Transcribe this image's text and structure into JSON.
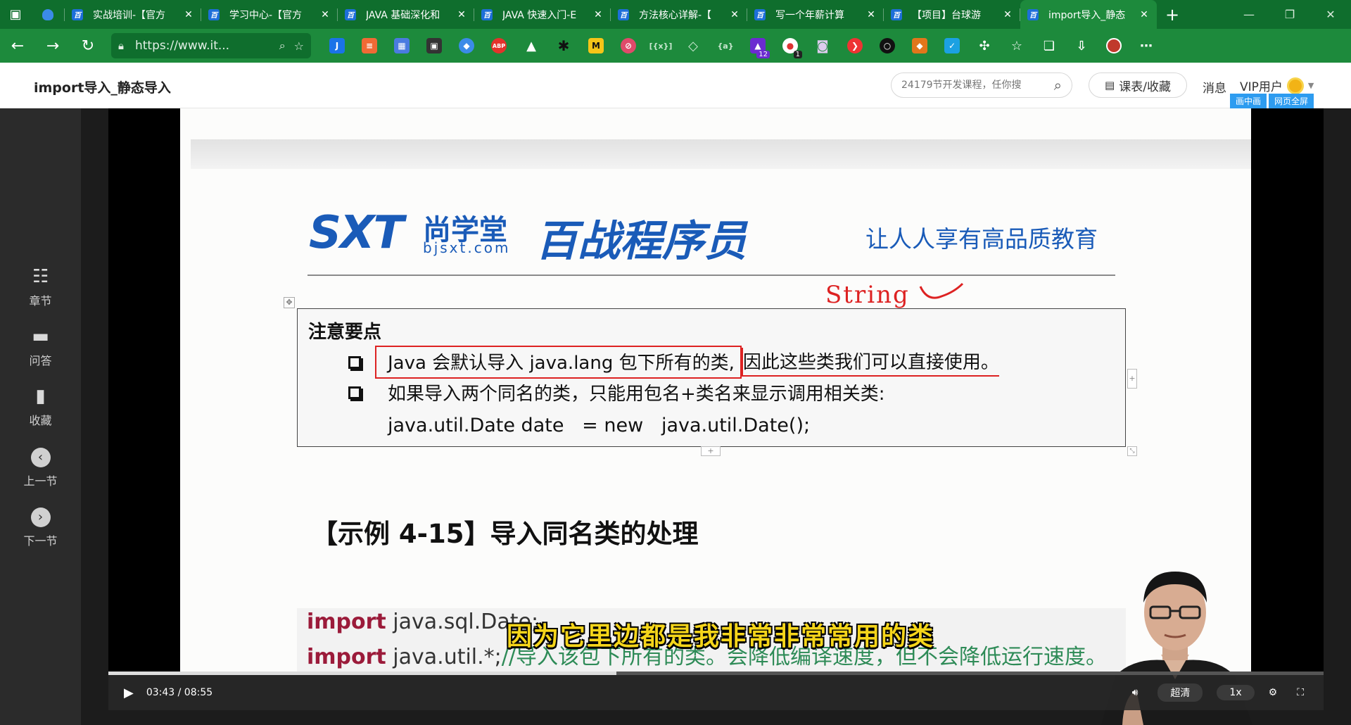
{
  "browser": {
    "tabs": [
      {
        "title": "",
        "favicon": "gem",
        "active": false
      },
      {
        "title": "实战培训-【官方",
        "favicon": "百",
        "active": false
      },
      {
        "title": "学习中心-【官方",
        "favicon": "百",
        "active": false
      },
      {
        "title": "JAVA 基础深化和",
        "favicon": "百",
        "active": false
      },
      {
        "title": "JAVA 快速入门-E",
        "favicon": "百",
        "active": false
      },
      {
        "title": "方法核心详解-【",
        "favicon": "百",
        "active": false
      },
      {
        "title": "写一个年薪计算",
        "favicon": "百",
        "active": false
      },
      {
        "title": "【项目】台球游",
        "favicon": "百",
        "active": false
      },
      {
        "title": "import导入_静态",
        "favicon": "百",
        "active": true
      }
    ],
    "url": "https://www.it...",
    "extension_badges": {
      "ext_purple": "12",
      "ext_red": "1"
    }
  },
  "header": {
    "page_title": "import导入_静态导入",
    "search_placeholder": "24179节开发课程，任你搜",
    "course_button": "课表/收藏",
    "messages": "消息",
    "vip": "VIP用户",
    "pip": "画中画",
    "fullpage": "网页全屏"
  },
  "sidebar": {
    "items": [
      {
        "label": "章节",
        "icon": "chapters-icon"
      },
      {
        "label": "问答",
        "icon": "qa-icon"
      },
      {
        "label": "收藏",
        "icon": "bookmark-icon"
      },
      {
        "label": "上一节",
        "icon": "prev-icon"
      },
      {
        "label": "下一节",
        "icon": "next-icon"
      }
    ]
  },
  "slide": {
    "logo_sxt": "SXT",
    "logo_cn": "尚学堂",
    "logo_url": "bjsxt.com",
    "logo_bz": "百战程序员",
    "slogan": "让人人享有高品质教育",
    "annotation": "String",
    "note_title": "注意要点",
    "note_1a": "Java 会默认导入 java.lang 包下所有的类,",
    "note_1b": " 因此这些类我们可以直接使用。",
    "note_2": "如果导入两个同名的类，只能用包名+类名来显示调用相关类:",
    "note_code": "java.util.Date date   = new   java.util.Date();",
    "example_title": "【示例 4-15】导入同名类的处理",
    "code_1_kw": "import",
    "code_1_rest": " java.sql.Date;",
    "code_2_kw": "import",
    "code_2_rest": " java.util.*;",
    "code_2_comment": "//导入该包下所有的类。会降低编译速度，但不会降低运行速度。",
    "subtitle": "因为它里边都是我非常非常常用的类"
  },
  "player": {
    "time": "03:43 / 08:55",
    "progress": 0.418,
    "quality": "超清",
    "speed": "1x"
  }
}
